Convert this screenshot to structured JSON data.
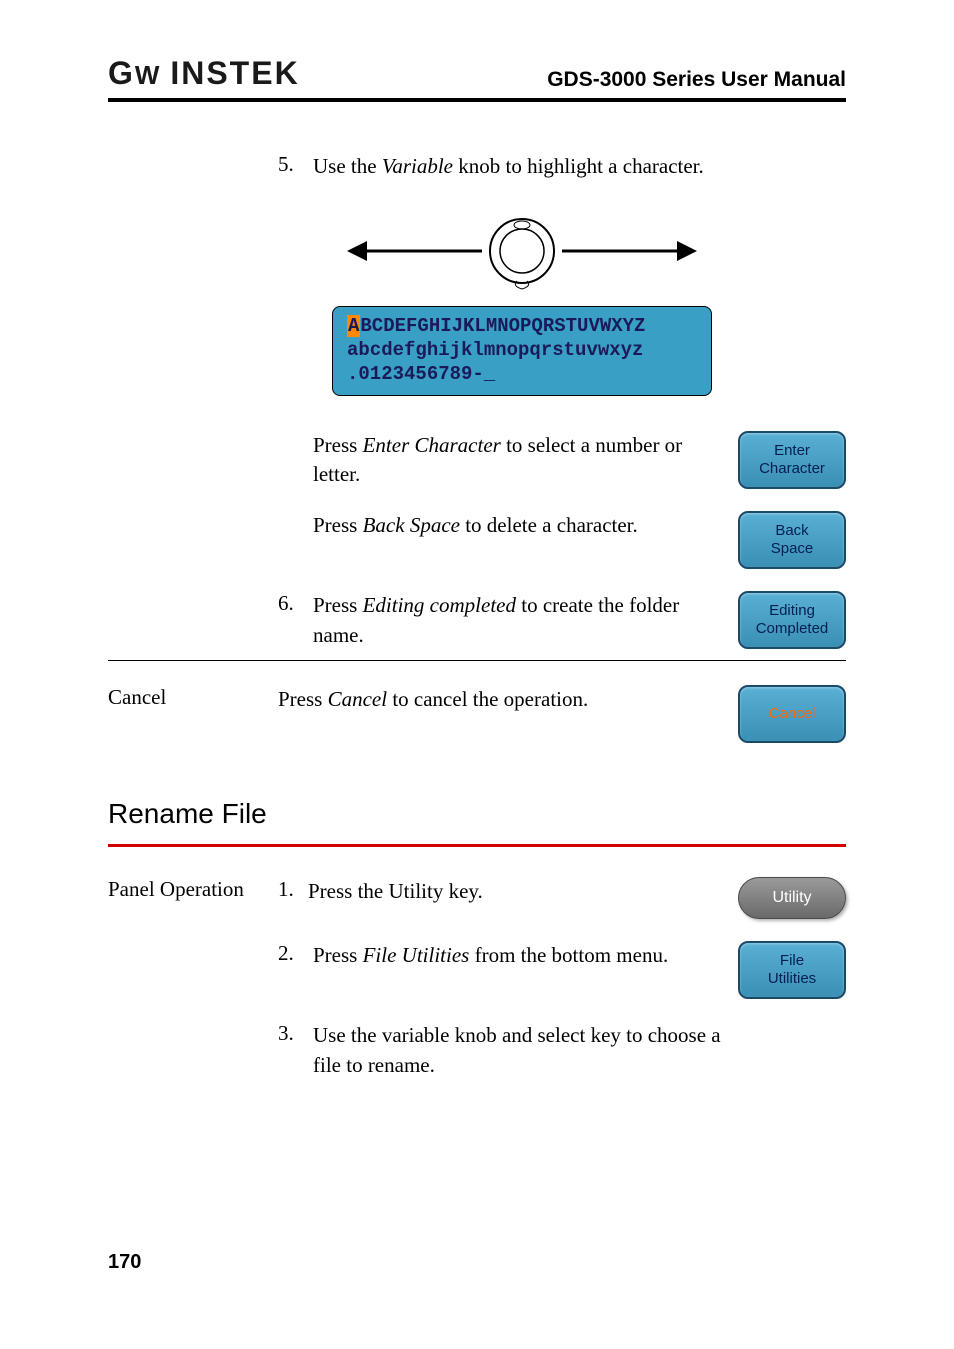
{
  "header": {
    "logo": "GW INSTEK",
    "manual_title": "GDS-3000 Series User Manual"
  },
  "section1": {
    "step5": {
      "num": "5.",
      "text_pre": "Use the ",
      "text_em": "Variable",
      "text_post": " knob to highlight a character."
    },
    "charbox": {
      "highlight": "A",
      "line1_rest": "BCDEFGHIJKLMNOPQRSTUVWXYZ",
      "line2": "abcdefghijklmnopqrstuvwxyz",
      "line3": ".0123456789-_"
    },
    "enter_char": {
      "text_pre": "Press ",
      "text_em": "Enter Character",
      "text_post": " to select a number or letter.",
      "button_line1": "Enter",
      "button_line2": "Character"
    },
    "back_space": {
      "text_pre": "Press ",
      "text_em": "Back Space",
      "text_post": " to delete a character.",
      "button_line1": "Back",
      "button_line2": "Space"
    },
    "step6": {
      "num": "6.",
      "text_pre": "Press ",
      "text_em": "Editing completed",
      "text_post": " to create the folder name.",
      "button_line1": "Editing",
      "button_line2": "Completed"
    },
    "cancel": {
      "label": "Cancel",
      "text_pre": "Press ",
      "text_em": "Cancel",
      "text_post": " to cancel the operation.",
      "button": "Cancel"
    }
  },
  "section2": {
    "heading": "Rename File",
    "panel_op": "Panel Operation",
    "step1": {
      "num": "1.",
      "text": "Press the Utility key.",
      "button": "Utility"
    },
    "step2": {
      "num": "2.",
      "text_pre": "Press ",
      "text_em": "File Utilities",
      "text_post": " from the bottom menu.",
      "button_line1": "File",
      "button_line2": "Utilities"
    },
    "step3": {
      "num": "3.",
      "text": "Use the variable knob and select key to choose a file to rename."
    }
  },
  "page_number": "170"
}
